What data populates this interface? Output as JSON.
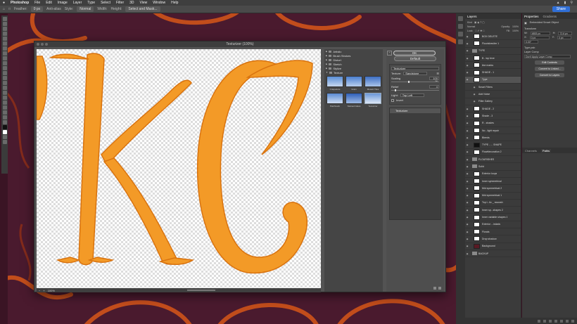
{
  "menubar": {
    "app": "Photoshop",
    "items": [
      "File",
      "Edit",
      "Image",
      "Layer",
      "Type",
      "Select",
      "Filter",
      "3D",
      "View",
      "Window",
      "Help"
    ]
  },
  "options": {
    "feather_label": "Feather:",
    "feather_value": "0 px",
    "antialias": "Anti-alias",
    "style_label": "Style:",
    "style_value": "Normal",
    "width_label": "Width:",
    "height_label": "Height:",
    "select_mask": "Select and Mask...",
    "share": "Share"
  },
  "dialog": {
    "title": "Texturizer (100%)",
    "zoom": "100%",
    "ok": "OK",
    "default": "Default",
    "filter_select": "Texturizer",
    "texture_label": "Texture:",
    "texture_value": "Sandstone",
    "scaling_label": "Scaling",
    "scaling_value": "100 %",
    "relief_label": "Relief",
    "relief_value": "4",
    "light_label": "Light:",
    "light_value": "Top Left",
    "invert_label": "Invert",
    "effect_item": "Texturizer"
  },
  "gallery": {
    "folders": [
      "Artistic",
      "Brush Strokes",
      "Distort",
      "Sketch",
      "Stylize",
      "Texture"
    ],
    "thumbs": [
      "Craquelure",
      "Grain",
      "Mosaic Tiles",
      "Patchwork",
      "Stained Glass",
      "Texturizer"
    ]
  },
  "layers_panel": {
    "tab": "Layers",
    "kind_label": "Kind",
    "blend_mode": "Normal",
    "opacity_label": "Opacity:",
    "opacity_value": "100%",
    "lock_label": "Lock:",
    "fill_label": "Fill:",
    "fill_value": "100%",
    "rows": [
      {
        "name": "BOX DELETE",
        "thumb": "white",
        "sel": false
      },
      {
        "name": "Flourishes/ter 1",
        "thumb": "white",
        "sel": false
      },
      {
        "name": "TYPE",
        "thumb": "folder",
        "sel": false
      },
      {
        "name": "B - top level",
        "thumb": "white",
        "sel": false
      },
      {
        "name": "line marks",
        "thumb": "white",
        "sel": false
      },
      {
        "name": "SHADE - 1",
        "thumb": "white",
        "sel": false
      },
      {
        "name": "Type",
        "thumb": "white",
        "sel": true
      },
      {
        "name": "Smart Filters",
        "thumb": "none",
        "sel": false
      },
      {
        "name": "Add Noise",
        "thumb": "none",
        "sel": false
      },
      {
        "name": "Filter Gallery",
        "thumb": "none",
        "sel": false
      },
      {
        "name": "SHADE - 2",
        "thumb": "white",
        "sel": false
      },
      {
        "name": "Shade - 3",
        "thumb": "white",
        "sel": false
      },
      {
        "name": "R - shades",
        "thumb": "white",
        "sel": false
      },
      {
        "name": "No - light repair",
        "thumb": "white",
        "sel": false
      },
      {
        "name": "Bleeds",
        "thumb": "white",
        "sel": false
      },
      {
        "name": "TYPE - ... SHAPE",
        "thumb": "dark",
        "sel": false
      },
      {
        "name": "Flowfdecoration 2",
        "thumb": "white",
        "sel": false
      },
      {
        "name": "FLOURISHES",
        "thumb": "folder",
        "sel": false
      },
      {
        "name": "Solid",
        "thumb": "folder",
        "sel": false
      },
      {
        "name": "Exterior loops",
        "thumb": "white",
        "sel": false
      },
      {
        "name": "Inner symmetrical",
        "thumb": "white",
        "sel": false
      },
      {
        "name": "Mid symmetrical 2",
        "thumb": "white",
        "sel": false
      },
      {
        "name": "Mid symmetrical 1",
        "thumb": "white",
        "sel": false
      },
      {
        "name": "Top l...tic _ swoosh",
        "thumb": "white",
        "sel": false
      },
      {
        "name": "Inner sp...shapes 2",
        "thumb": "white",
        "sel": false
      },
      {
        "name": "Inner variable shapes 1",
        "thumb": "white",
        "sel": false
      },
      {
        "name": "Exterior ...irclads",
        "thumb": "white",
        "sel": false
      },
      {
        "name": "Florals",
        "thumb": "white",
        "sel": false
      },
      {
        "name": "Drop shadow",
        "thumb": "white",
        "sel": false
      },
      {
        "name": "Background",
        "thumb": "red",
        "sel": false
      },
      {
        "name": "BACKUP",
        "thumb": "folder",
        "sel": false
      }
    ]
  },
  "properties": {
    "tabs": [
      "Properties",
      "Gradients"
    ],
    "title": "Embedded Smart Object",
    "transform": "Transform",
    "w_label": "W:",
    "w_value": "4853 px",
    "h_label": "H:",
    "h_value": "72.6 px",
    "x_label": "X:",
    "x_value": "0 px",
    "y_label": "Y:",
    "y_value": "0 px",
    "angle": "0.00°",
    "type_file": "Type.psb",
    "layer_comp": "Layer Comp",
    "layer_comp_value": "Don't Apply Layer Comp",
    "edit_contents": "Edit Contents",
    "convert_linked": "Convert to Linked...",
    "convert_layers": "Convert to Layers"
  },
  "lower_tabs": [
    "Channels",
    "Paths"
  ],
  "colors": {
    "letter_orange": "#f39a27",
    "letter_shade": "#d9730f",
    "background": "#3a1424",
    "selection": "#545454",
    "share_blue": "#2f6fd8"
  }
}
